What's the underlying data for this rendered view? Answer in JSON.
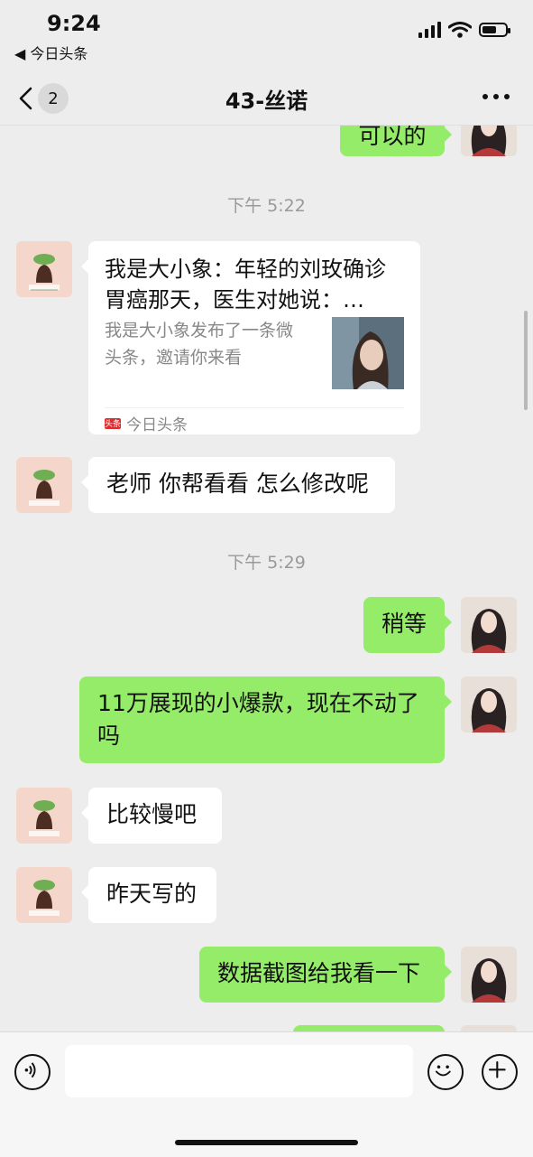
{
  "status_bar": {
    "time": "9:24",
    "back_app": "◀ 今日头条"
  },
  "nav": {
    "unread_count": "2",
    "title": "43-丝诺"
  },
  "messages": {
    "m0": "可以的",
    "t1": "下午 5:22",
    "card": {
      "title": "我是大小象：年轻的刘玫确诊胃癌那天，医生对她说：…",
      "desc": "我是大小象发布了一条微头条，邀请你来看",
      "source": "今日头条",
      "source_icon": "头条"
    },
    "m2": "老师 你帮看看 怎么修改呢",
    "t2": "下午 5:29",
    "m3": "稍等",
    "m4": "11万展现的小爆款，现在不动了吗",
    "m5": "比较慢吧",
    "m6": "昨天写的",
    "m7": "数据截图给我看一下"
  },
  "input": {
    "placeholder": ""
  },
  "colors": {
    "background": "#ededed",
    "out_bubble": "#95ec69",
    "in_bubble": "#ffffff",
    "toutiao_red": "#e02c2c"
  },
  "icons": [
    "chevron-left-icon",
    "more-icon",
    "voice-icon",
    "emoji-icon",
    "plus-icon",
    "signal-icon",
    "wifi-icon",
    "battery-icon"
  ]
}
